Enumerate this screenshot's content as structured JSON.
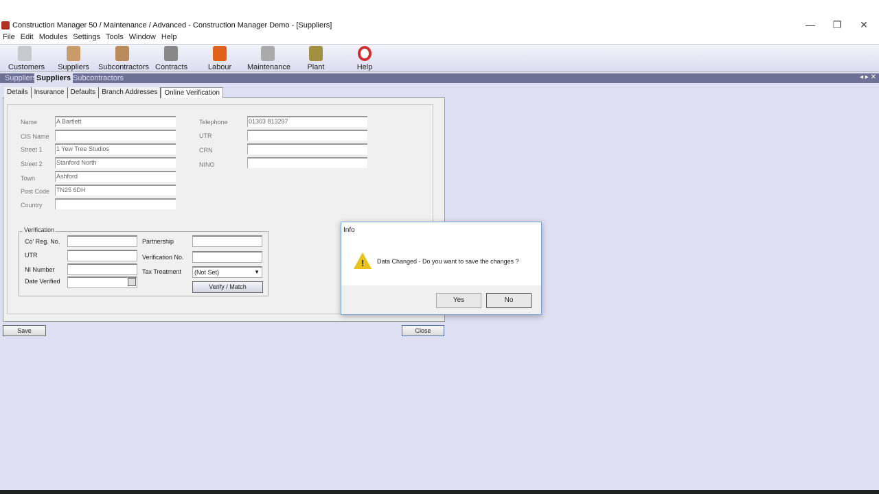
{
  "window": {
    "title": "Construction Manager 50 / Maintenance / Advanced  - Construction Manager Demo - [Suppliers]",
    "min": "—",
    "restore": "❐",
    "close": "✕"
  },
  "menu": [
    "File",
    "Edit",
    "Modules",
    "Settings",
    "Tools",
    "Window",
    "Help"
  ],
  "toolbar": [
    {
      "label": "Customers",
      "color": "#c8c8d0"
    },
    {
      "label": "Suppliers",
      "color": "#c99a6a"
    },
    {
      "label": "Subcontractors",
      "color": "#b98a5a"
    },
    {
      "label": "Contracts",
      "color": "#888"
    },
    {
      "label": "Labour",
      "color": "#e0601a"
    },
    {
      "label": "Maintenance",
      "color": "#aaa"
    },
    {
      "label": "Plant",
      "color": "#a09040"
    },
    {
      "label": "Help",
      "color": "#d03030"
    }
  ],
  "module_tabs": [
    "Suppliers",
    "Suppliers",
    "Subcontractors"
  ],
  "tab_nav": {
    "prev": "◂",
    "next": "▸",
    "close": "✕"
  },
  "sub_tabs": [
    "Details",
    "Insurance",
    "Defaults",
    "Branch Addresses",
    "Online Verification"
  ],
  "form": {
    "left": [
      {
        "label": "Name",
        "value": "A Bartlett"
      },
      {
        "label": "CIS Name",
        "value": ""
      },
      {
        "label": "Street 1",
        "value": "1 Yew Tree Studios"
      },
      {
        "label": "Street 2",
        "value": "Stanford North"
      },
      {
        "label": "Town",
        "value": "Ashford"
      },
      {
        "label": "Post Code",
        "value": "TN25 6DH"
      },
      {
        "label": "Country",
        "value": ""
      }
    ],
    "right": [
      {
        "label": "Telephone",
        "value": "01303 813297"
      },
      {
        "label": "UTR",
        "value": ""
      },
      {
        "label": "CRN",
        "value": ""
      },
      {
        "label": "NINO",
        "value": ""
      }
    ]
  },
  "verification": {
    "title": "Verification",
    "co_reg": "Co' Reg. No.",
    "utr": "UTR",
    "ni": "NI Number",
    "date": "Date Verified",
    "partnership": "Partnership",
    "verif_no": "Verification No.",
    "tax": "Tax Treatment",
    "tax_value": "(Not Set)",
    "verify_button": "Verify / Match"
  },
  "buttons": {
    "save": "Save",
    "close": "Close"
  },
  "dialog": {
    "title": "Info",
    "message": "Data Changed - Do you want to save the changes ?",
    "yes": "Yes",
    "no": "No"
  }
}
